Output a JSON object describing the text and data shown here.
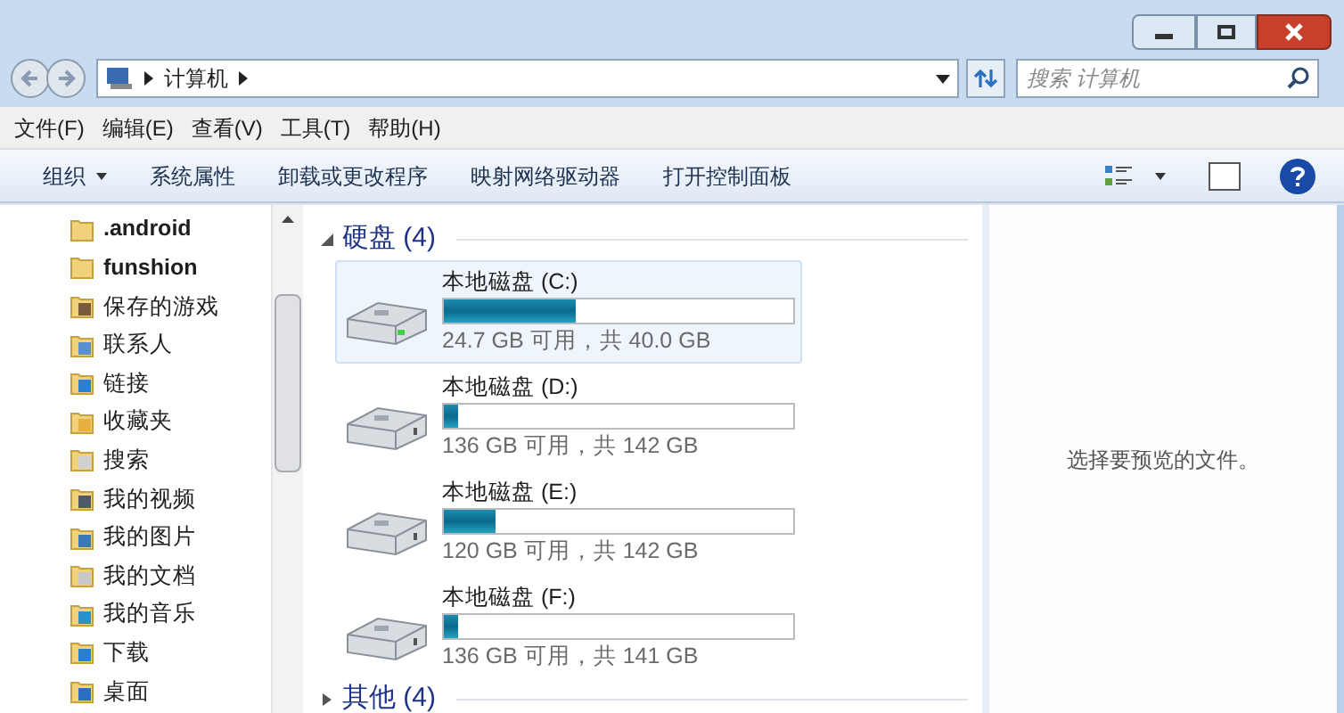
{
  "address": {
    "path": "计算机",
    "search_placeholder": "搜索 计算机"
  },
  "menu": [
    "文件(F)",
    "编辑(E)",
    "查看(V)",
    "工具(T)",
    "帮助(H)"
  ],
  "toolbar": [
    {
      "label": "组织",
      "dropdown": true
    },
    {
      "label": "系统属性",
      "dropdown": false
    },
    {
      "label": "卸载或更改程序",
      "dropdown": false
    },
    {
      "label": "映射网络驱动器",
      "dropdown": false
    },
    {
      "label": "打开控制面板",
      "dropdown": false
    }
  ],
  "sidebar": {
    "items": [
      {
        "label": ".android",
        "kind": "folder",
        "bold": true
      },
      {
        "label": "funshion",
        "kind": "folder",
        "bold": true
      },
      {
        "label": "保存的游戏",
        "kind": "games",
        "bold": false
      },
      {
        "label": "联系人",
        "kind": "contacts",
        "bold": false
      },
      {
        "label": "链接",
        "kind": "links",
        "bold": false
      },
      {
        "label": "收藏夹",
        "kind": "favorites",
        "bold": false
      },
      {
        "label": "搜索",
        "kind": "search",
        "bold": false
      },
      {
        "label": "我的视频",
        "kind": "videos",
        "bold": false
      },
      {
        "label": "我的图片",
        "kind": "pictures",
        "bold": false
      },
      {
        "label": "我的文档",
        "kind": "documents",
        "bold": false
      },
      {
        "label": "我的音乐",
        "kind": "music",
        "bold": false
      },
      {
        "label": "下载",
        "kind": "downloads",
        "bold": false
      },
      {
        "label": "桌面",
        "kind": "desktop",
        "bold": false
      }
    ]
  },
  "groups": [
    {
      "title": "硬盘 (4)",
      "expanded": true,
      "drives": [
        {
          "name": "本地磁盘 (C:)",
          "level": 0.38,
          "info": "24.7 GB 可用，共 40.0 GB",
          "selected": true,
          "system": true
        },
        {
          "name": "本地磁盘 (D:)",
          "level": 0.04,
          "info": "136 GB 可用，共 142 GB",
          "selected": false,
          "system": false
        },
        {
          "name": "本地磁盘 (E:)",
          "level": 0.15,
          "info": "120 GB 可用，共 142 GB",
          "selected": false,
          "system": false
        },
        {
          "name": "本地磁盘 (F:)",
          "level": 0.04,
          "info": "136 GB 可用，共 141 GB",
          "selected": false,
          "system": false
        }
      ]
    },
    {
      "title": "其他 (4)",
      "expanded": false
    }
  ],
  "preview": {
    "message": "选择要预览的文件。"
  }
}
